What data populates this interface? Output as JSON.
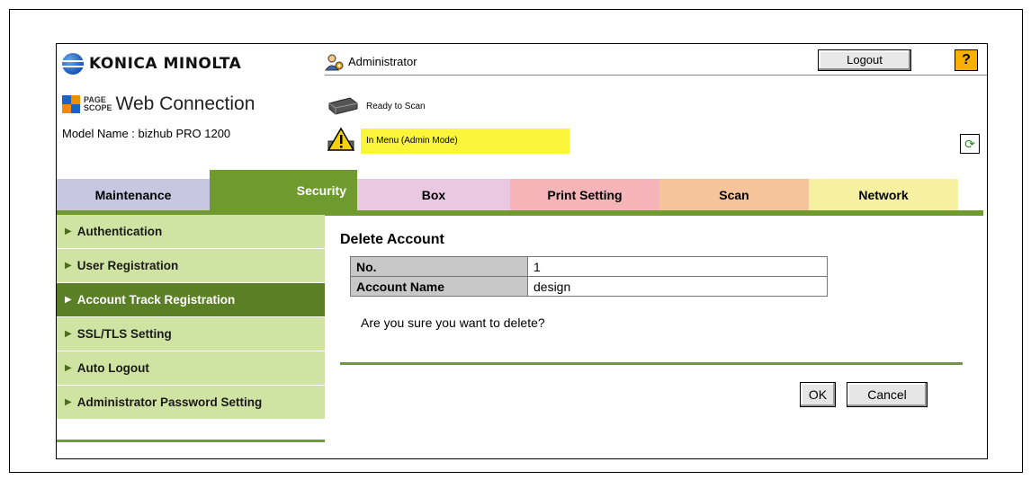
{
  "header": {
    "brand_name": "KONICA MINOLTA",
    "pagescope_small_top": "PAGE",
    "pagescope_small_bottom": "SCOPE",
    "product_name": "Web Connection",
    "model_name": "Model Name : bizhub PRO 1200",
    "user_label": "Administrator",
    "logout_label": "Logout",
    "help_label": "?",
    "status_scan": "Ready to Scan",
    "status_menu": "In Menu (Admin Mode)"
  },
  "tabs": [
    {
      "label": "Maintenance",
      "color": "#c9c6e2"
    },
    {
      "label": "Security",
      "color": "#6e9a2e"
    },
    {
      "label": "Box",
      "color": "#e9c8e2"
    },
    {
      "label": "Print Setting",
      "color": "#f4b4b8"
    },
    {
      "label": "Scan",
      "color": "#f6c49a"
    },
    {
      "label": "Network",
      "color": "#f6f0a2"
    }
  ],
  "sidebar": {
    "items": [
      {
        "label": "Authentication"
      },
      {
        "label": "User Registration"
      },
      {
        "label": "Account Track Registration"
      },
      {
        "label": "SSL/TLS Setting"
      },
      {
        "label": "Auto Logout"
      },
      {
        "label": "Administrator Password Setting"
      }
    ]
  },
  "content": {
    "title": "Delete Account",
    "rows": [
      {
        "label": "No.",
        "value": "1"
      },
      {
        "label": "Account Name",
        "value": "design"
      }
    ],
    "confirm_text": "Are you sure you want to delete?",
    "ok_label": "OK",
    "cancel_label": "Cancel"
  }
}
